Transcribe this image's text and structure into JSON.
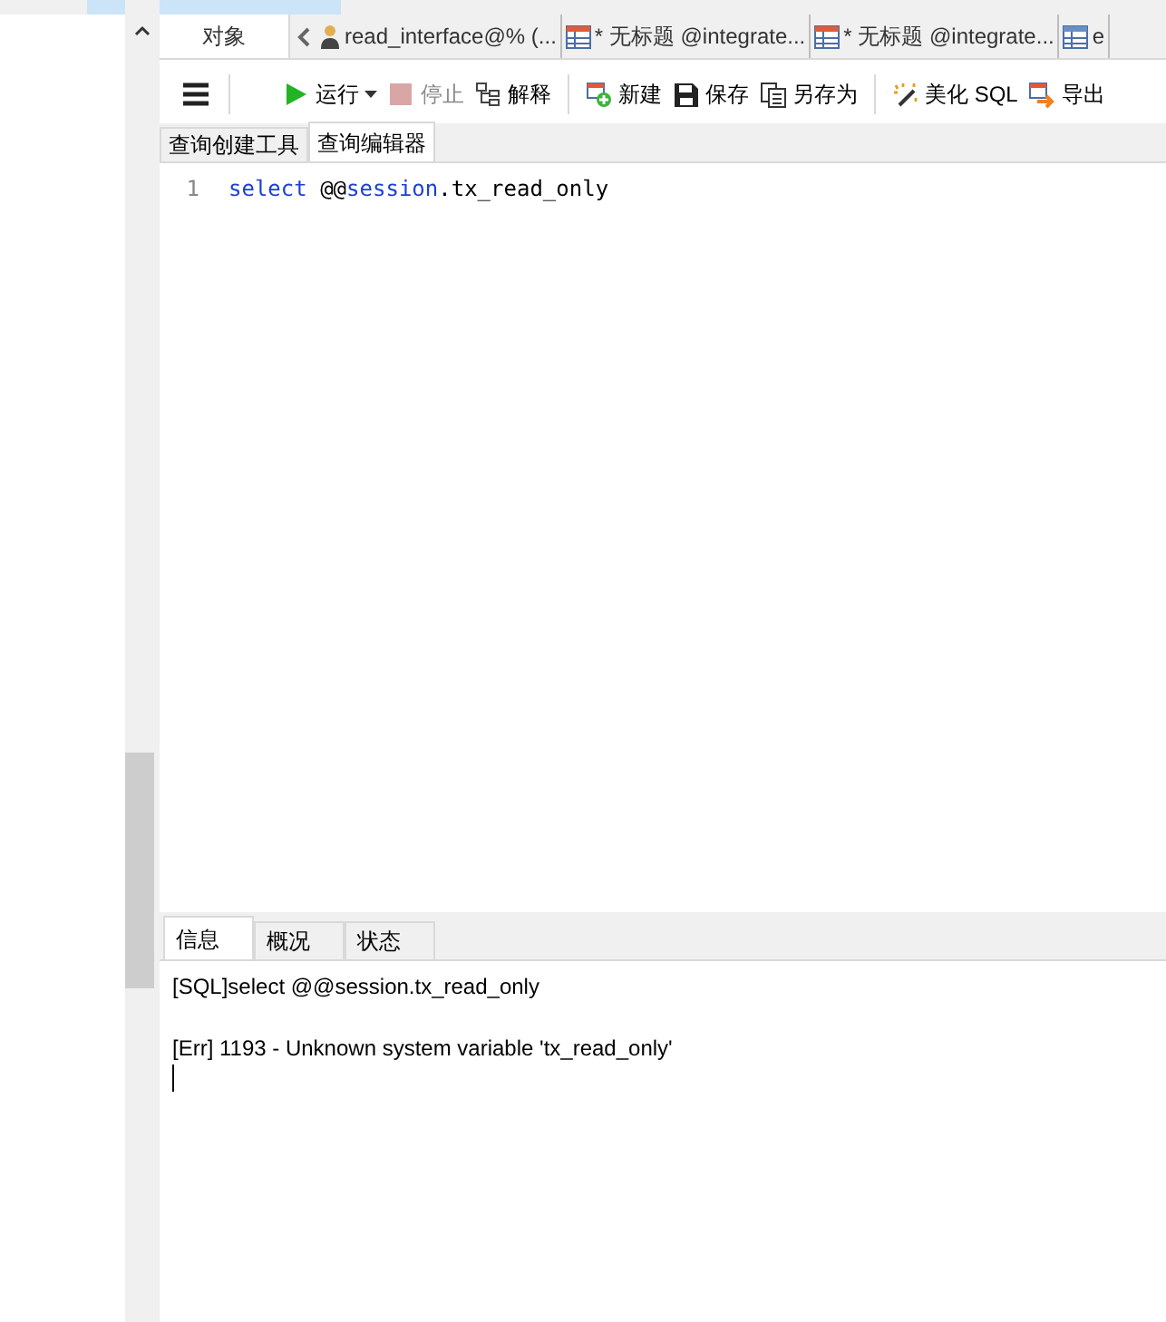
{
  "doc_tabs": [
    {
      "label": "对象",
      "kind": "objects"
    },
    {
      "label": "read_interface@% (...",
      "kind": "user"
    },
    {
      "label": "* 无标题 @integrate...",
      "kind": "query"
    },
    {
      "label": "* 无标题 @integrate...",
      "kind": "query"
    },
    {
      "label": "e",
      "kind": "table"
    }
  ],
  "toolbar": [
    {
      "kind": "menu"
    },
    {
      "kind": "run",
      "label": "运行",
      "disabled": false
    },
    {
      "kind": "stop",
      "label": "停止",
      "disabled": true
    },
    {
      "kind": "explain",
      "label": "解释",
      "disabled": false
    },
    {
      "kind": "new",
      "label": "新建",
      "disabled": false
    },
    {
      "kind": "save",
      "label": "保存",
      "disabled": false
    },
    {
      "kind": "saveas",
      "label": "另存为",
      "disabled": false
    },
    {
      "kind": "beautify",
      "label": "美化 SQL",
      "disabled": false
    },
    {
      "kind": "export",
      "label": "导出",
      "disabled": false
    }
  ],
  "editor_tabs": [
    {
      "label": "查询创建工具",
      "selected": false
    },
    {
      "label": "查询编辑器",
      "selected": true
    }
  ],
  "editor": {
    "lines": [
      {
        "number": "1",
        "tokens": [
          {
            "kind": "keyword",
            "text": "select"
          },
          {
            "kind": "plain",
            "text": " @@"
          },
          {
            "kind": "keyword",
            "text": "session"
          },
          {
            "kind": "plain",
            "text": ".tx_read_only"
          }
        ]
      }
    ]
  },
  "result_tabs": [
    {
      "label": "信息",
      "selected": true
    },
    {
      "label": "概况",
      "selected": false
    },
    {
      "label": "状态",
      "selected": false
    }
  ],
  "messages": [
    "[SQL]select @@session.tx_read_only",
    "[Err] 1193 - Unknown system variable 'tx_read_only'"
  ]
}
